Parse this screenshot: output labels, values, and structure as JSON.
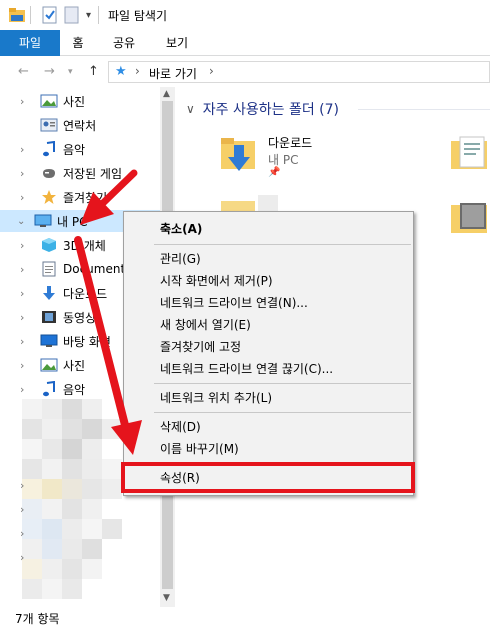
{
  "window": {
    "title": "파일 탐색기"
  },
  "ribbon": {
    "tabs": [
      {
        "label": "파일"
      },
      {
        "label": "홈"
      },
      {
        "label": "공유"
      },
      {
        "label": "보기"
      }
    ]
  },
  "address": {
    "separator": "›",
    "crumb": "바로 가기"
  },
  "nav": {
    "items": [
      {
        "label": "사진",
        "icon": "pictures-icon",
        "expand": true
      },
      {
        "label": "연락처",
        "icon": "contacts-icon",
        "expand": false
      },
      {
        "label": "음악",
        "icon": "music-icon",
        "expand": true
      },
      {
        "label": "저장된 게임",
        "icon": "saved-games-icon",
        "expand": true
      },
      {
        "label": "즐겨찾기",
        "icon": "favorites-icon",
        "expand": true
      },
      {
        "label": "내 PC",
        "icon": "this-pc-icon",
        "expand": "open",
        "selected": true
      },
      {
        "label": "3D 개체",
        "icon": "3d-objects-icon",
        "expand": true
      },
      {
        "label": "Documents",
        "icon": "documents-icon",
        "expand": true
      },
      {
        "label": "다운로드",
        "icon": "downloads-icon",
        "expand": true
      },
      {
        "label": "동영상",
        "icon": "videos-icon",
        "expand": true
      },
      {
        "label": "바탕 화면",
        "icon": "desktop-icon",
        "expand": true
      },
      {
        "label": "사진",
        "icon": "pictures-icon",
        "expand": true
      },
      {
        "label": "음악",
        "icon": "music-icon",
        "expand": true
      }
    ]
  },
  "main": {
    "group_title": "자주 사용하는 폴더 (7)",
    "folders": [
      {
        "name": "다운로드",
        "location": "내 PC"
      }
    ]
  },
  "context_menu": {
    "items": [
      {
        "label": "축소(A)",
        "bold": true
      },
      {
        "sep": true
      },
      {
        "label": "관리(G)"
      },
      {
        "label": "시작 화면에서 제거(P)"
      },
      {
        "label": "네트워크 드라이브 연결(N)..."
      },
      {
        "label": "새 창에서 열기(E)"
      },
      {
        "label": "즐겨찾기에 고정"
      },
      {
        "label": "네트워크 드라이브 연결 끊기(C)..."
      },
      {
        "sep": true
      },
      {
        "label": "네트워크 위치 추가(L)"
      },
      {
        "sep": true
      },
      {
        "label": "삭제(D)"
      },
      {
        "label": "이름 바꾸기(M)"
      },
      {
        "sep": true
      },
      {
        "label": "속성(R)"
      }
    ]
  },
  "status": {
    "text": "7개 항목"
  },
  "colors": {
    "accent": "#1979ca",
    "highlight": "#e5141c",
    "selection": "#cce8ff"
  }
}
